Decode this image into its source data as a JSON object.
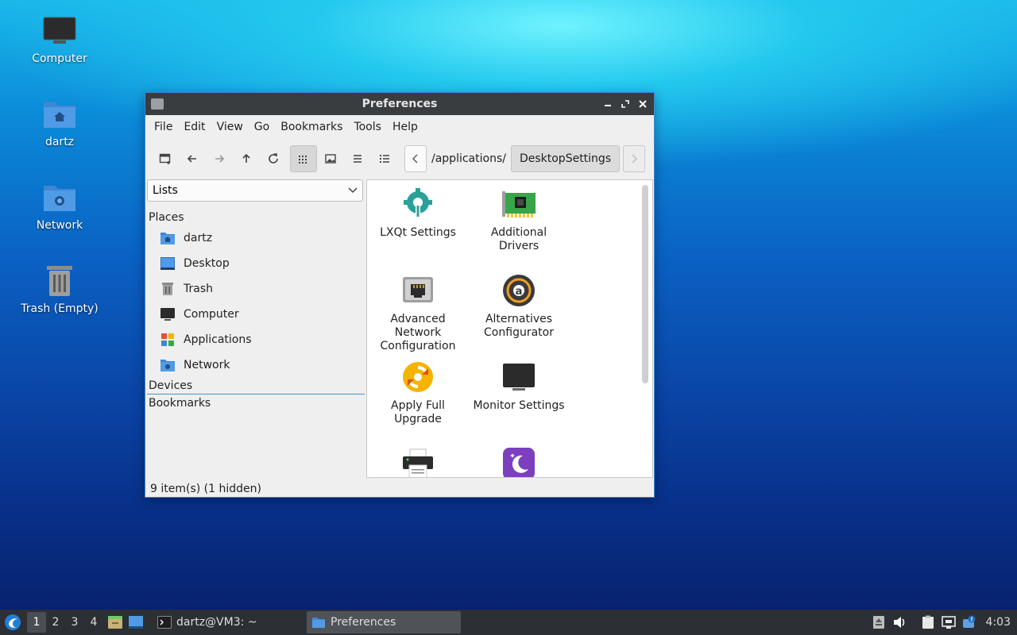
{
  "desktop": {
    "icons": [
      {
        "label": "Computer"
      },
      {
        "label": "dartz"
      },
      {
        "label": "Network"
      },
      {
        "label": "Trash (Empty)"
      }
    ]
  },
  "window": {
    "title": "Preferences",
    "menu": [
      "File",
      "Edit",
      "View",
      "Go",
      "Bookmarks",
      "Tools",
      "Help"
    ],
    "path": {
      "text": "/applications/",
      "crumb": "DesktopSettings"
    },
    "sidebar": {
      "view_select": "Lists",
      "places_header": "Places",
      "places": [
        {
          "label": "dartz",
          "icon": "home-folder-icon"
        },
        {
          "label": "Desktop",
          "icon": "desktop-icon"
        },
        {
          "label": "Trash",
          "icon": "trash-icon"
        },
        {
          "label": "Computer",
          "icon": "computer-icon"
        },
        {
          "label": "Applications",
          "icon": "applications-icon"
        },
        {
          "label": "Network",
          "icon": "network-folder-icon"
        }
      ],
      "devices_header": "Devices",
      "bookmarks_header": "Bookmarks"
    },
    "items": [
      {
        "label": "LXQt Settings",
        "icon": "lxqt-settings-icon"
      },
      {
        "label": "Additional Drivers",
        "icon": "drivers-card-icon"
      },
      {
        "label": "Advanced Network Configuration",
        "icon": "network-port-icon"
      },
      {
        "label": "Alternatives Configurator",
        "icon": "alternatives-icon"
      },
      {
        "label": "Apply Full Upgrade",
        "icon": "upgrade-icon"
      },
      {
        "label": "Monitor Settings",
        "icon": "monitor-icon"
      },
      {
        "label": "",
        "icon": "printer-icon"
      },
      {
        "label": "",
        "icon": "night-mode-icon"
      }
    ],
    "status": "9 item(s) (1 hidden)"
  },
  "taskbar": {
    "workspaces": [
      "1",
      "2",
      "3",
      "4"
    ],
    "tasks": [
      {
        "label": "dartz@VM3: ~"
      },
      {
        "label": "Preferences"
      }
    ],
    "clock": "4:03"
  },
  "colors": {
    "titlebar": "#3a3d40",
    "accent": "#3b89d6",
    "taskbar": "#2c2f33"
  }
}
